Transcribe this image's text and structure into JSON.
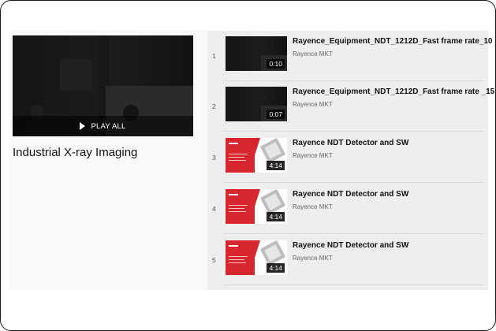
{
  "playlist": {
    "title": "Industrial X-ray Imaging",
    "play_all_label": "PLAY ALL"
  },
  "videos": [
    {
      "index": "1",
      "title": "Rayence_Equipment_NDT_1212D_Fast frame rate_10",
      "channel": "Rayence MKT",
      "duration": "0:10",
      "thumbnail": "dark-xray"
    },
    {
      "index": "2",
      "title": "Rayence_Equipment_NDT_1212D_Fast frame rate _15",
      "channel": "Rayence MKT",
      "duration": "0:07",
      "thumbnail": "dark-xray"
    },
    {
      "index": "3",
      "title": "Rayence NDT Detector and SW",
      "channel": "Rayence MKT",
      "duration": "4:14",
      "thumbnail": "red-promo"
    },
    {
      "index": "4",
      "title": "Rayence NDT Detector and SW",
      "channel": "Rayence MKT",
      "duration": "4:14",
      "thumbnail": "red-promo"
    },
    {
      "index": "5",
      "title": "Rayence NDT Detector and SW",
      "channel": "Rayence MKT",
      "duration": "4:14",
      "thumbnail": "red-promo"
    }
  ],
  "colors": {
    "promo_red": "#d8262f",
    "list_background": "#eeeeee"
  },
  "icons": {
    "play_all": "play-icon"
  }
}
